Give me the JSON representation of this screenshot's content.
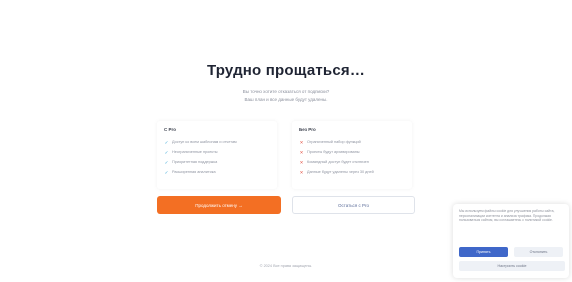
{
  "main": {
    "heading": "Трудно прощаться…",
    "subtitle_line1": "Вы точно хотите отказаться от подписки?",
    "subtitle_line2": "Ваш план и все данные будут удалены."
  },
  "compare": {
    "left": {
      "title": "С Pro",
      "features": [
        "Доступ ко всем шаблонам и отчетам",
        "Неограниченные проекты",
        "Приоритетная поддержка",
        "Расширенная аналитика"
      ]
    },
    "right": {
      "title": "Без Pro",
      "features": [
        "Ограниченный набор функций",
        "Проекты будут архивированы",
        "Командный доступ будет отключен",
        "Данные будут удалены через 30 дней"
      ]
    }
  },
  "actions": {
    "leave_label": "Продолжить отмену →",
    "stay_label": "Остаться с Pro"
  },
  "footer": {
    "text": "© 2024 Все права защищены."
  },
  "cookie": {
    "text": "Мы используем файлы cookie для улучшения работы сайта, персонализации контента и анализа трафика. Продолжая пользоваться сайтом, вы соглашаетесь с политикой cookie.",
    "accept_label": "Принять",
    "reject_label": "Отклонить",
    "manage_label": "Настроить cookie"
  },
  "colors": {
    "primary_orange": "#f36f23",
    "cookie_blue": "#3f67c9",
    "check_blue": "#3ba8d8",
    "cross_red": "#e4574a"
  },
  "icons": {
    "check": "check-icon",
    "cross": "cross-icon"
  }
}
